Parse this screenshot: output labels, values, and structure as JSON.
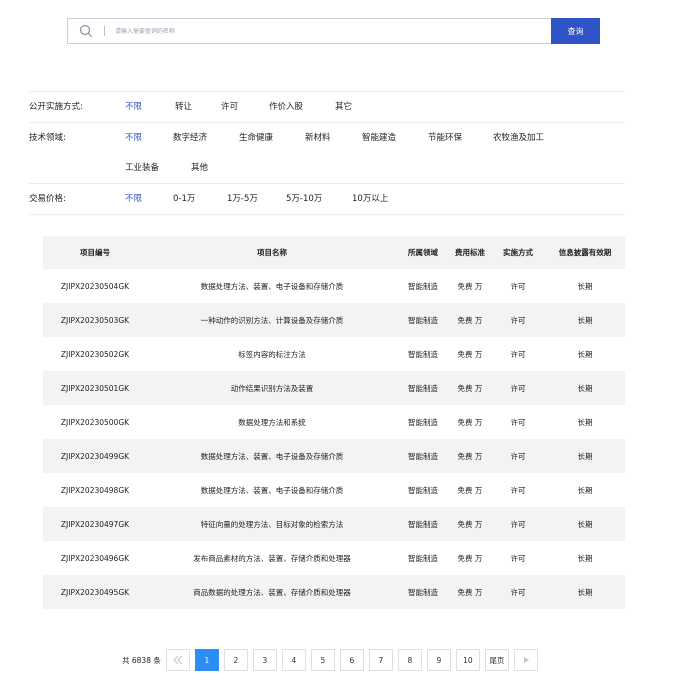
{
  "search": {
    "placeholder": "请输入需要查询的名称",
    "button_label": "查询"
  },
  "filters": [
    {
      "label": "公开实施方式:",
      "name": "implementation",
      "options": [
        {
          "text": "不限",
          "active": true
        },
        {
          "text": "转让",
          "active": false
        },
        {
          "text": "许可",
          "active": false
        },
        {
          "text": "作价入股",
          "active": false
        },
        {
          "text": "其它",
          "active": false
        }
      ]
    },
    {
      "label": "技术领域:",
      "name": "tech-field",
      "options": [
        {
          "text": "不限",
          "active": true
        },
        {
          "text": "数字经济",
          "active": false
        },
        {
          "text": "生命健康",
          "active": false
        },
        {
          "text": "新材料",
          "active": false
        },
        {
          "text": "智能建造",
          "active": false
        },
        {
          "text": "节能环保",
          "active": false
        },
        {
          "text": "农牧渔及加工",
          "active": false
        },
        {
          "text": "工业装备",
          "active": false
        },
        {
          "text": "其他",
          "active": false
        }
      ]
    },
    {
      "label": "交易价格:",
      "name": "price",
      "options": [
        {
          "text": "不限",
          "active": true
        },
        {
          "text": "0-1万",
          "active": false
        },
        {
          "text": "1万-5万",
          "active": false
        },
        {
          "text": "5万-10万",
          "active": false
        },
        {
          "text": "10万以上",
          "active": false
        }
      ]
    }
  ],
  "table": {
    "headers": [
      "项目编号",
      "项目名称",
      "所属领域",
      "费用标准",
      "实施方式",
      "信息披露有效期"
    ],
    "rows": [
      [
        "ZJIPX20230504GK",
        "数据处理方法、装置、电子设备和存储介质",
        "智能制造",
        "免费 万",
        "许可",
        "长期"
      ],
      [
        "ZJIPX20230503GK",
        "一种动作的识别方法、计算设备及存储介质",
        "智能制造",
        "免费 万",
        "许可",
        "长期"
      ],
      [
        "ZJIPX20230502GK",
        "标签内容的标注方法",
        "智能制造",
        "免费 万",
        "许可",
        "长期"
      ],
      [
        "ZJIPX20230501GK",
        "动作结果识别方法及装置",
        "智能制造",
        "免费 万",
        "许可",
        "长期"
      ],
      [
        "ZJIPX20230500GK",
        "数据处理方法和系统",
        "智能制造",
        "免费 万",
        "许可",
        "长期"
      ],
      [
        "ZJIPX20230499GK",
        "数据处理方法、装置、电子设备及存储介质",
        "智能制造",
        "免费 万",
        "许可",
        "长期"
      ],
      [
        "ZJIPX20230498GK",
        "数据处理方法、装置、电子设备和存储介质",
        "智能制造",
        "免费 万",
        "许可",
        "长期"
      ],
      [
        "ZJIPX20230497GK",
        "特征向量的处理方法、目标对象的检索方法",
        "智能制造",
        "免费 万",
        "许可",
        "长期"
      ],
      [
        "ZJIPX20230496GK",
        "发布商品素材的方法、装置、存储介质和处理器",
        "智能制造",
        "免费 万",
        "许可",
        "长期"
      ],
      [
        "ZJIPX20230495GK",
        "商品数据的处理方法、装置、存储介质和处理器",
        "智能制造",
        "免费 万",
        "许可",
        "长期"
      ]
    ]
  },
  "pagination": {
    "total_text": "共 6838 条",
    "prev_icon": "double-left-arrow",
    "pages": [
      "1",
      "2",
      "3",
      "4",
      "5",
      "6",
      "7",
      "8",
      "9",
      "10"
    ],
    "current": "1",
    "last_label": "尾页",
    "next_icon": "right-arrow"
  },
  "colors": {
    "accent": "#2f54c8",
    "page_active": "#2c8ef5",
    "row_alt": "#f2f3f5"
  }
}
